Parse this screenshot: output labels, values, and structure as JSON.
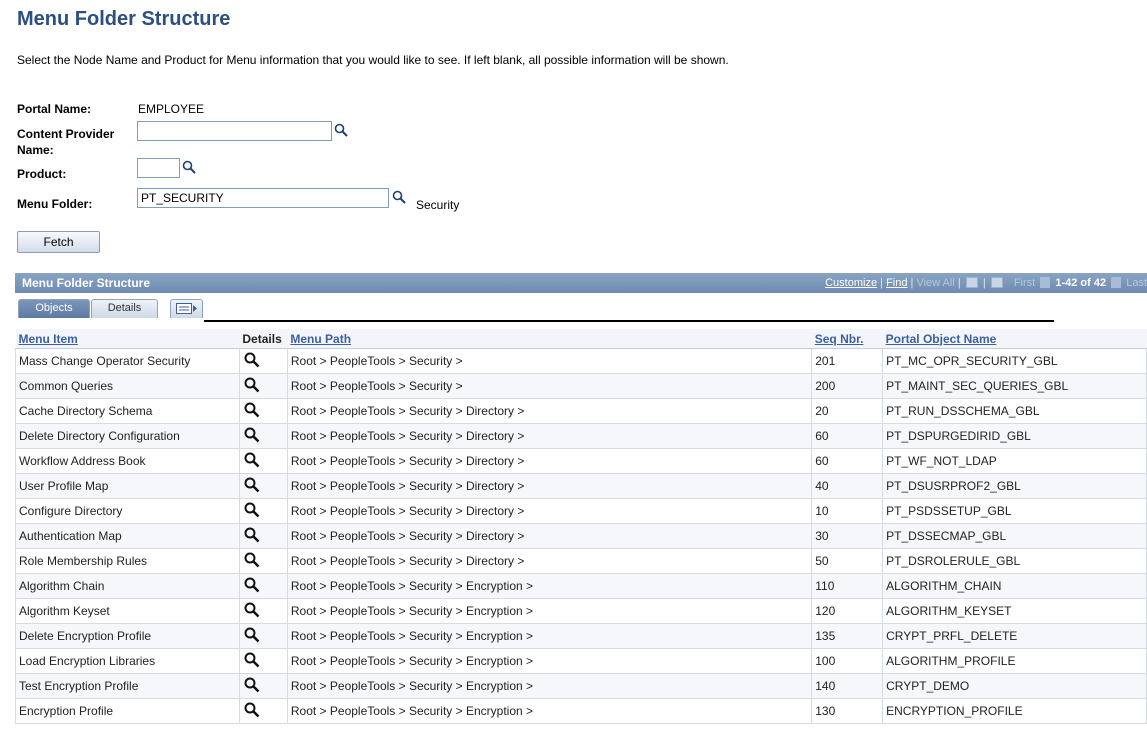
{
  "page": {
    "title": "Menu Folder Structure",
    "instructions": "Select the Node Name and Product for Menu information that you would like to see. If left blank, all possible information will be shown."
  },
  "form": {
    "portal_name_label": "Portal Name:",
    "portal_name_value": "EMPLOYEE",
    "content_provider_label_line1": "Content Provider",
    "content_provider_label_line2": "Name:",
    "content_provider_value": "",
    "product_label": "Product:",
    "product_value": "",
    "menu_folder_label": "Menu Folder:",
    "menu_folder_value": "PT_SECURITY",
    "menu_folder_description": "Security",
    "fetch_label": "Fetch"
  },
  "grid": {
    "title": "Menu Folder Structure",
    "nav": {
      "customize": "Customize",
      "find": "Find",
      "view_all": "View All",
      "first": "First",
      "range": "1-42 of 42",
      "last": "Last",
      "sep": "|"
    },
    "tabs": {
      "objects": "Objects",
      "details": "Details"
    },
    "columns": {
      "menu_item": "Menu Item",
      "details": "Details",
      "menu_path": "Menu Path",
      "seq_nbr": "Seq Nbr.",
      "portal_object_name": "Portal Object Name"
    },
    "rows": [
      {
        "menu_item": "Mass Change Operator Security",
        "menu_path": "Root > PeopleTools > Security >",
        "seq": "201",
        "object": "PT_MC_OPR_SECURITY_GBL"
      },
      {
        "menu_item": "Common Queries",
        "menu_path": "Root > PeopleTools > Security >",
        "seq": "200",
        "object": "PT_MAINT_SEC_QUERIES_GBL"
      },
      {
        "menu_item": "Cache Directory Schema",
        "menu_path": "Root > PeopleTools > Security > Directory >",
        "seq": "20",
        "object": "PT_RUN_DSSCHEMA_GBL"
      },
      {
        "menu_item": "Delete Directory Configuration",
        "menu_path": "Root > PeopleTools > Security > Directory >",
        "seq": "60",
        "object": "PT_DSPURGEDIRID_GBL"
      },
      {
        "menu_item": "Workflow Address Book",
        "menu_path": "Root > PeopleTools > Security > Directory >",
        "seq": "60",
        "object": "PT_WF_NOT_LDAP"
      },
      {
        "menu_item": "User Profile Map",
        "menu_path": "Root > PeopleTools > Security > Directory >",
        "seq": "40",
        "object": "PT_DSUSRPROF2_GBL"
      },
      {
        "menu_item": "Configure Directory",
        "menu_path": "Root > PeopleTools > Security > Directory >",
        "seq": "10",
        "object": "PT_PSDSSETUP_GBL"
      },
      {
        "menu_item": "Authentication Map",
        "menu_path": "Root > PeopleTools > Security > Directory >",
        "seq": "30",
        "object": "PT_DSSECMAP_GBL"
      },
      {
        "menu_item": "Role Membership Rules",
        "menu_path": "Root > PeopleTools > Security > Directory >",
        "seq": "50",
        "object": "PT_DSROLERULE_GBL"
      },
      {
        "menu_item": "Algorithm Chain",
        "menu_path": "Root > PeopleTools > Security > Encryption >",
        "seq": "110",
        "object": "ALGORITHM_CHAIN"
      },
      {
        "menu_item": "Algorithm Keyset",
        "menu_path": "Root > PeopleTools > Security > Encryption >",
        "seq": "120",
        "object": "ALGORITHM_KEYSET"
      },
      {
        "menu_item": "Delete Encryption Profile",
        "menu_path": "Root > PeopleTools > Security > Encryption >",
        "seq": "135",
        "object": "CRYPT_PRFL_DELETE"
      },
      {
        "menu_item": "Load Encryption Libraries",
        "menu_path": "Root > PeopleTools > Security > Encryption >",
        "seq": "100",
        "object": "ALGORITHM_PROFILE"
      },
      {
        "menu_item": "Test Encryption Profile",
        "menu_path": "Root > PeopleTools > Security > Encryption >",
        "seq": "140",
        "object": "CRYPT_DEMO"
      },
      {
        "menu_item": "Encryption Profile",
        "menu_path": "Root > PeopleTools > Security > Encryption >",
        "seq": "130",
        "object": "ENCRYPTION_PROFILE"
      }
    ]
  },
  "icons": {
    "lookup": "magnifier-icon",
    "details": "magnifier-icon",
    "zoom": "zoom-icon",
    "download": "spreadsheet-icon",
    "show_all_columns": "show-all-columns-icon"
  },
  "colors": {
    "title": "#2b4f85",
    "grid_header": "#6d8bb1",
    "link": "#3c5fa0"
  }
}
